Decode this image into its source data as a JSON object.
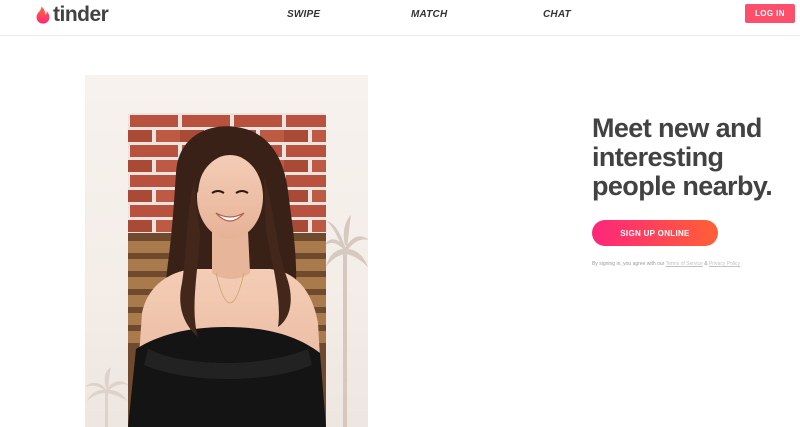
{
  "header": {
    "logo_text": "tinder",
    "logo_icon": "flame-icon",
    "nav": [
      {
        "label": "SWIPE"
      },
      {
        "label": "MATCH"
      },
      {
        "label": "CHAT"
      }
    ],
    "login_label": "LOG IN"
  },
  "hero": {
    "headline": "Meet new and interesting people nearby.",
    "signup_label": "SIGN UP ONLINE",
    "legal": {
      "prefix": "By signing in, you agree with our",
      "terms_link": "Terms of Service",
      "separator": "&",
      "privacy_link": "Privacy Policy"
    }
  },
  "colors": {
    "brand": "#fd4f6b",
    "gradient_start": "#fd267a",
    "gradient_end": "#ff6036",
    "text": "#424242"
  }
}
